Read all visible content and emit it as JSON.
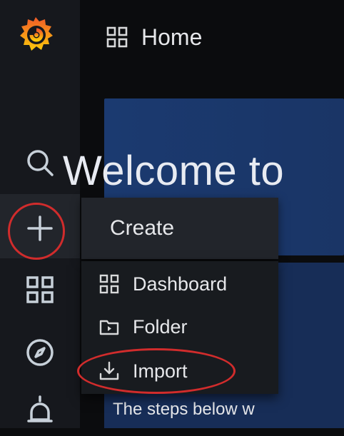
{
  "header": {
    "title": "Home",
    "icon": "dashboards-grid-icon"
  },
  "welcome": {
    "text": "Welcome to"
  },
  "panel": {
    "steps_text": "The steps below w"
  },
  "sidebar": {
    "items": [
      {
        "name": "search",
        "icon": "search-icon"
      },
      {
        "name": "create",
        "icon": "plus-icon"
      },
      {
        "name": "dashboards",
        "icon": "grid-icon"
      },
      {
        "name": "explore",
        "icon": "compass-icon"
      },
      {
        "name": "alerting",
        "icon": "bell-icon"
      }
    ]
  },
  "create_menu": {
    "header": "Create",
    "items": [
      {
        "label": "Dashboard",
        "icon": "apps-icon"
      },
      {
        "label": "Folder",
        "icon": "folder-plus-icon"
      },
      {
        "label": "Import",
        "icon": "import-icon"
      }
    ]
  },
  "colors": {
    "background": "#0b0c0e",
    "sidebar": "#16181d",
    "menu": "#22252b",
    "panel_blue": "#1b3a70",
    "annotation_red": "#d12c2c",
    "logo_orange": "#f05a28",
    "logo_yellow": "#fbca0a"
  }
}
